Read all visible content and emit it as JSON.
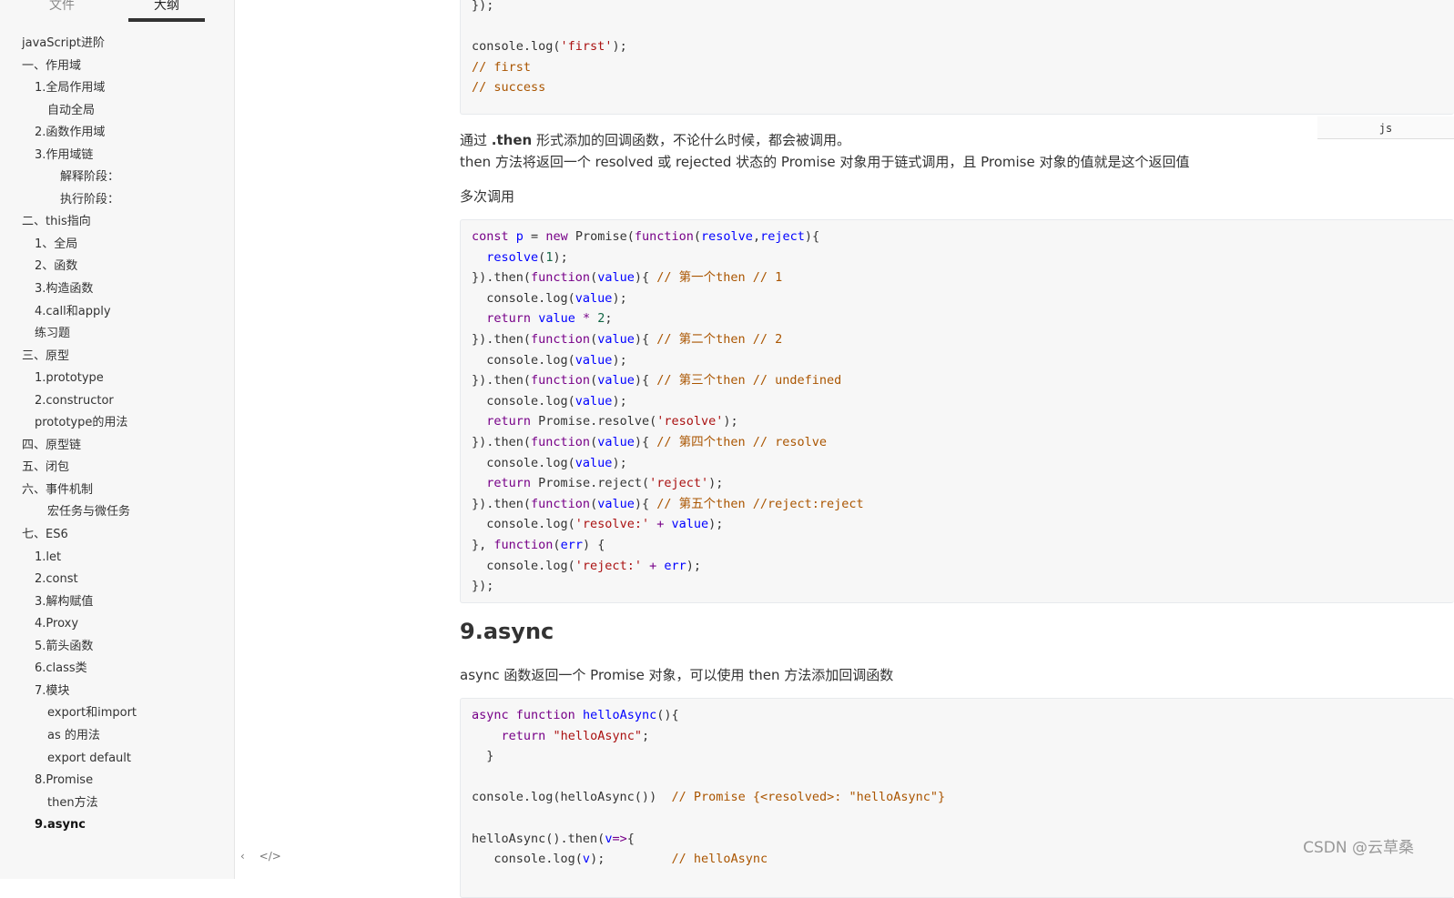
{
  "sidebar": {
    "tab_files": "文件",
    "tab_outline": "大纲",
    "items": [
      {
        "label": "javaScript进阶",
        "level": 1
      },
      {
        "label": "一、作用域",
        "level": 1
      },
      {
        "label": "1.全局作用域",
        "level": 2
      },
      {
        "label": "自动全局",
        "level": 3
      },
      {
        "label": "2.函数作用域",
        "level": 2
      },
      {
        "label": "3.作用域链",
        "level": 2
      },
      {
        "label": "解释阶段：",
        "level": 4
      },
      {
        "label": "执行阶段：",
        "level": 4
      },
      {
        "label": "二、this指向",
        "level": 1
      },
      {
        "label": "1、全局",
        "level": 2
      },
      {
        "label": "2、函数",
        "level": 2
      },
      {
        "label": "3.构造函数",
        "level": 2
      },
      {
        "label": "4.call和apply",
        "level": 2
      },
      {
        "label": "练习题",
        "level": 2
      },
      {
        "label": "三、原型",
        "level": 1
      },
      {
        "label": "1.prototype",
        "level": 2
      },
      {
        "label": "2.constructor",
        "level": 2
      },
      {
        "label": "prototype的用法",
        "level": 2
      },
      {
        "label": "四、原型链",
        "level": 1
      },
      {
        "label": "五、闭包",
        "level": 1
      },
      {
        "label": "六、事件机制",
        "level": 1
      },
      {
        "label": "宏任务与微任务",
        "level": 3
      },
      {
        "label": "七、ES6",
        "level": 1
      },
      {
        "label": "1.let",
        "level": 2
      },
      {
        "label": "2.const",
        "level": 2
      },
      {
        "label": "3.解构赋值",
        "level": 2
      },
      {
        "label": "4.Proxy",
        "level": 2
      },
      {
        "label": "5.箭头函数",
        "level": 2
      },
      {
        "label": "6.class类",
        "level": 2
      },
      {
        "label": "7.模块",
        "level": 2
      },
      {
        "label": "export和import",
        "level": 3
      },
      {
        "label": "as 的用法",
        "level": 3
      },
      {
        "label": "export default",
        "level": 3
      },
      {
        "label": "8.Promise",
        "level": 2
      },
      {
        "label": "then方法",
        "level": 3
      },
      {
        "label": "9.async",
        "level": 2,
        "active": true
      }
    ],
    "bottom_left": "‹",
    "bottom_code": "</>"
  },
  "content": {
    "code1_line1": "});",
    "code1_line3": "console.log(",
    "code1_str": "'first'",
    "code1_end": ");",
    "code1_c1": "// first",
    "code1_c2": "// success",
    "lang": "js",
    "para1_a": "通过 ",
    "para1_b": ".then",
    "para1_c": " 形式添加的回调函数，不论什么时候，都会被调用。",
    "para2": "then 方法将返回一个 resolved 或 rejected 状态的 Promise 对象用于链式调用，且 Promise 对象的值就是这个返回值",
    "para3": "多次调用",
    "h_async": "9.async",
    "para4": "async 函数返回一个 Promise 对象，可以使用 then 方法添加回调函数",
    "watermark": "CSDN @云草桑"
  }
}
